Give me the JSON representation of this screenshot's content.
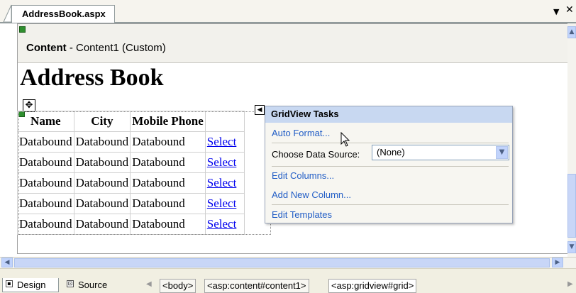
{
  "document_tab": {
    "title": "AddressBook.aspx",
    "dropdown_icon": "chevron-down-icon",
    "close_icon": "close-icon"
  },
  "content_region": {
    "control": "Content",
    "description": " - Content1 (Custom)"
  },
  "page": {
    "heading": "Address Book"
  },
  "grid": {
    "columns": [
      "Name",
      "City",
      "Mobile Phone"
    ],
    "rows": [
      [
        "Databound",
        "Databound",
        "Databound",
        "Select"
      ],
      [
        "Databound",
        "Databound",
        "Databound",
        "Select"
      ],
      [
        "Databound",
        "Databound",
        "Databound",
        "Select"
      ],
      [
        "Databound",
        "Databound",
        "Databound",
        "Select"
      ],
      [
        "Databound",
        "Databound",
        "Databound",
        "Select"
      ]
    ]
  },
  "tasks_panel": {
    "title": "GridView Tasks",
    "auto_format": "Auto Format...",
    "choose_data_source_label": "Choose Data Source:",
    "data_source_value": "(None)",
    "edit_columns": "Edit Columns...",
    "add_new_column": "Add New Column...",
    "edit_templates": "Edit Templates"
  },
  "view_tabs": {
    "design": "Design",
    "source": "Source"
  },
  "breadcrumbs": [
    "<body>",
    "<asp:content#content1>",
    "<asp:gridview#grid>"
  ],
  "colors": {
    "panel_header": "#c8d8f1",
    "link": "#215dc6",
    "grid_link": "#0000ee"
  }
}
